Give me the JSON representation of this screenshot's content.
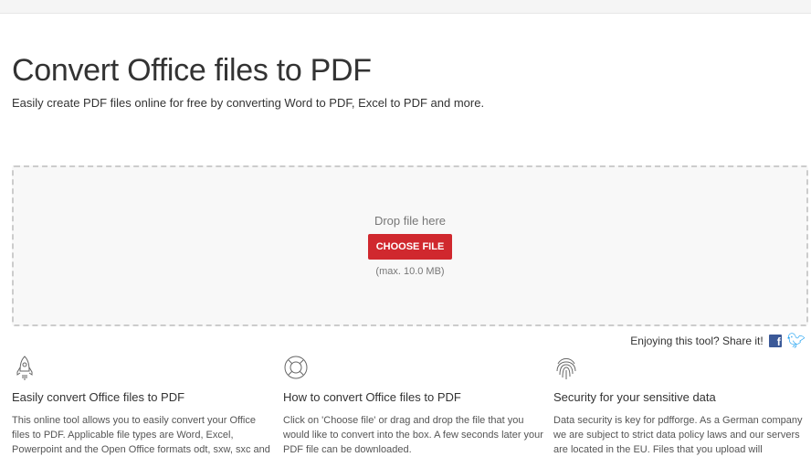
{
  "page": {
    "title": "Convert Office files to PDF",
    "subtitle": "Easily create PDF files online for free by converting Word to PDF, Excel to PDF and more."
  },
  "upload": {
    "drop_text": "Drop file here",
    "button": "CHOOSE FILE",
    "max": "(max. 10.0 MB)"
  },
  "share": {
    "text": "Enjoying this tool? Share it!"
  },
  "features": [
    {
      "icon": "rocket-icon",
      "title": "Easily convert Office files to PDF",
      "text": "This online tool allows you to easily convert your Office files to PDF. Applicable file types are Word, Excel, Powerpoint and the Open Office formats odt, sxw, sxc and"
    },
    {
      "icon": "lifebuoy-icon",
      "title": "How to convert Office files to PDF",
      "text": "Click on 'Choose file' or drag and drop the file that you would like to convert into the box. A few seconds later your PDF file can be downloaded."
    },
    {
      "icon": "fingerprint-icon",
      "title": "Security for your sensitive data",
      "text": "Data security is key for pdfforge. As a German company we are subject to strict data policy laws and our servers are located in the EU. Files that you upload will"
    }
  ]
}
